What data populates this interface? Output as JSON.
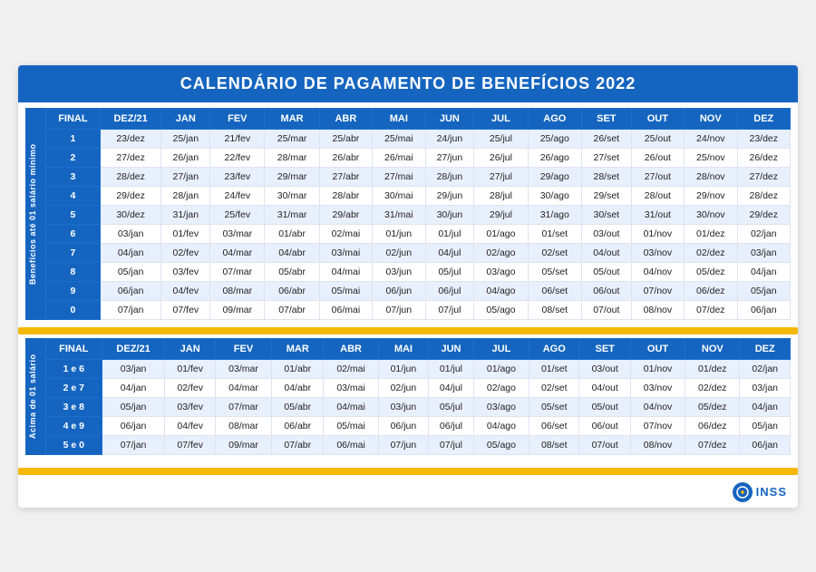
{
  "title": "CALENDÁRIO DE PAGAMENTO DE BENEFÍCIOS 2022",
  "section1": {
    "side_label": "Benefícios até 01 salário mínimo",
    "headers": [
      "FINAL",
      "DEZ/21",
      "JAN",
      "FEV",
      "MAR",
      "ABR",
      "MAI",
      "JUN",
      "JUL",
      "AGO",
      "SET",
      "OUT",
      "NOV",
      "DEZ"
    ],
    "rows": [
      [
        "1",
        "23/dez",
        "25/jan",
        "21/fev",
        "25/mar",
        "25/abr",
        "25/mai",
        "24/jun",
        "25/jul",
        "25/ago",
        "26/set",
        "25/out",
        "24/nov",
        "23/dez"
      ],
      [
        "2",
        "27/dez",
        "26/jan",
        "22/fev",
        "28/mar",
        "26/abr",
        "26/mai",
        "27/jun",
        "26/jul",
        "26/ago",
        "27/set",
        "26/out",
        "25/nov",
        "26/dez"
      ],
      [
        "3",
        "28/dez",
        "27/jan",
        "23/fev",
        "29/mar",
        "27/abr",
        "27/mai",
        "28/jun",
        "27/jul",
        "29/ago",
        "28/set",
        "27/out",
        "28/nov",
        "27/dez"
      ],
      [
        "4",
        "29/dez",
        "28/jan",
        "24/fev",
        "30/mar",
        "28/abr",
        "30/mai",
        "29/jun",
        "28/jul",
        "30/ago",
        "29/set",
        "28/out",
        "29/nov",
        "28/dez"
      ],
      [
        "5",
        "30/dez",
        "31/jan",
        "25/fev",
        "31/mar",
        "29/abr",
        "31/mai",
        "30/jun",
        "29/jul",
        "31/ago",
        "30/set",
        "31/out",
        "30/nov",
        "29/dez"
      ],
      [
        "6",
        "03/jan",
        "01/fev",
        "03/mar",
        "01/abr",
        "02/mai",
        "01/jun",
        "01/jul",
        "01/ago",
        "01/set",
        "03/out",
        "01/nov",
        "01/dez",
        "02/jan"
      ],
      [
        "7",
        "04/jan",
        "02/fev",
        "04/mar",
        "04/abr",
        "03/mai",
        "02/jun",
        "04/jul",
        "02/ago",
        "02/set",
        "04/out",
        "03/nov",
        "02/dez",
        "03/jan"
      ],
      [
        "8",
        "05/jan",
        "03/fev",
        "07/mar",
        "05/abr",
        "04/mai",
        "03/jun",
        "05/jul",
        "03/ago",
        "05/set",
        "05/out",
        "04/nov",
        "05/dez",
        "04/jan"
      ],
      [
        "9",
        "06/jan",
        "04/fev",
        "08/mar",
        "06/abr",
        "05/mai",
        "06/jun",
        "06/jul",
        "04/ago",
        "06/set",
        "06/out",
        "07/nov",
        "06/dez",
        "05/jan"
      ],
      [
        "0",
        "07/jan",
        "07/fev",
        "09/mar",
        "07/abr",
        "06/mai",
        "07/jun",
        "07/jul",
        "05/ago",
        "08/set",
        "07/out",
        "08/nov",
        "07/dez",
        "06/jan"
      ]
    ]
  },
  "section2": {
    "side_label": "Acima de 01 salário",
    "headers": [
      "FINAL",
      "DEZ/21",
      "JAN",
      "FEV",
      "MAR",
      "ABR",
      "MAI",
      "JUN",
      "JUL",
      "AGO",
      "SET",
      "OUT",
      "NOV",
      "DEZ"
    ],
    "rows": [
      [
        "1 e 6",
        "03/jan",
        "01/fev",
        "03/mar",
        "01/abr",
        "02/mai",
        "01/jun",
        "01/jul",
        "01/ago",
        "01/set",
        "03/out",
        "01/nov",
        "01/dez",
        "02/jan"
      ],
      [
        "2 e 7",
        "04/jan",
        "02/fev",
        "04/mar",
        "04/abr",
        "03/mai",
        "02/jun",
        "04/jul",
        "02/ago",
        "02/set",
        "04/out",
        "03/nov",
        "02/dez",
        "03/jan"
      ],
      [
        "3 e 8",
        "05/jan",
        "03/fev",
        "07/mar",
        "05/abr",
        "04/mai",
        "03/jun",
        "05/jul",
        "03/ago",
        "05/set",
        "05/out",
        "04/nov",
        "05/dez",
        "04/jan"
      ],
      [
        "4 e 9",
        "06/jan",
        "04/fev",
        "08/mar",
        "06/abr",
        "05/mai",
        "06/jun",
        "06/jul",
        "04/ago",
        "06/set",
        "06/out",
        "07/nov",
        "06/dez",
        "05/jan"
      ],
      [
        "5 e 0",
        "07/jan",
        "07/fev",
        "09/mar",
        "07/abr",
        "06/mai",
        "07/jun",
        "07/jul",
        "05/ago",
        "08/set",
        "07/out",
        "08/nov",
        "07/dez",
        "06/jan"
      ]
    ]
  },
  "footer": {
    "logo_text": "INSS"
  }
}
